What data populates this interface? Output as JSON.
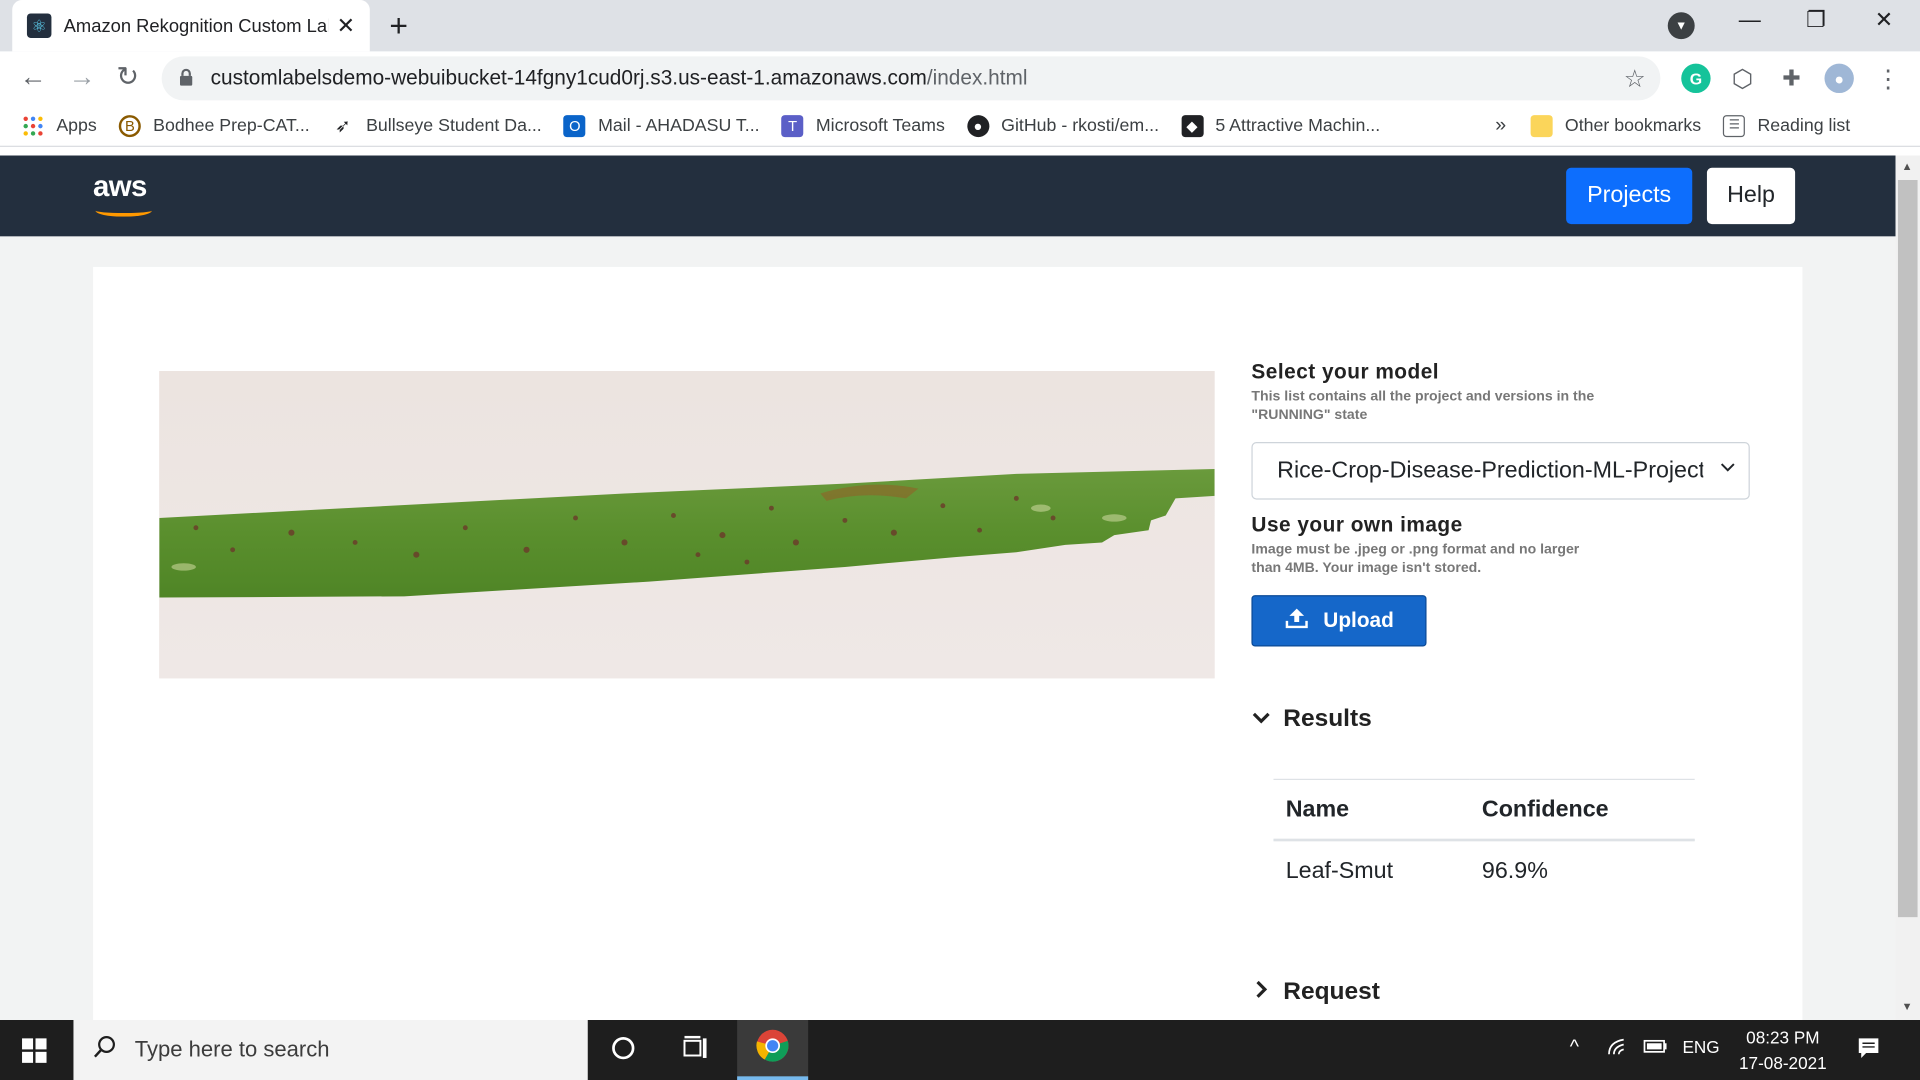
{
  "browser": {
    "tab_title": "Amazon Rekognition Custom Labels",
    "new_tab": "+",
    "url_host": "customlabelsdemo-webuibucket-14fgny1cud0rj.s3.us-east-1.amazonaws.com",
    "url_path": "/index.html",
    "bookmarks": [
      {
        "label": "Apps"
      },
      {
        "label": "Bodhee Prep-CAT..."
      },
      {
        "label": "Bullseye Student Da..."
      },
      {
        "label": "Mail - AHADASU T..."
      },
      {
        "label": "Microsoft Teams"
      },
      {
        "label": "GitHub - rkosti/em..."
      },
      {
        "label": "5 Attractive Machin..."
      }
    ],
    "overflow": "»",
    "other_bookmarks": "Other bookmarks",
    "reading_list": "Reading list"
  },
  "header": {
    "logo": "aws",
    "projects_label": "Projects",
    "help_label": "Help"
  },
  "model": {
    "heading": "Select your model",
    "description": "This list contains all the project and versions in the \"RUNNING\" state",
    "selected": "Rice-Crop-Disease-Prediction-ML-Project"
  },
  "upload": {
    "heading": "Use your own image",
    "description": "Image must be .jpeg or .png format and no larger than 4MB. Your image isn't stored.",
    "button_label": "Upload"
  },
  "results": {
    "heading": "Results",
    "columns": [
      "Name",
      "Confidence"
    ],
    "rows": [
      {
        "name": "Leaf-Smut",
        "confidence": "96.9%"
      }
    ]
  },
  "request": {
    "heading": "Request"
  },
  "taskbar": {
    "search_placeholder": "Type here to search",
    "language": "ENG",
    "time": "08:23 PM",
    "date": "17-08-2021"
  },
  "colors": {
    "aws_nav": "#232f3e",
    "aws_orange": "#ff9900",
    "primary_button": "#0d6efd",
    "upload_button": "#1567c9"
  }
}
